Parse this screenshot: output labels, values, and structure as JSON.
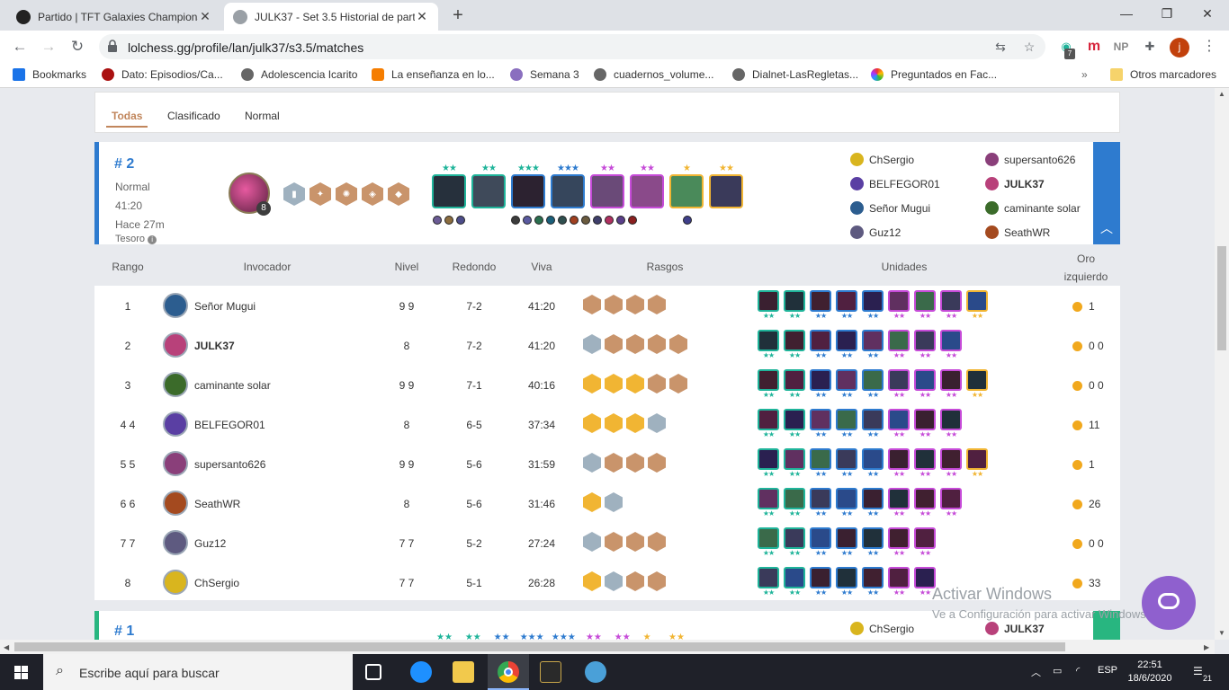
{
  "browser": {
    "tabs": [
      {
        "title": "Partido | TFT Galaxies Champions",
        "active": false
      },
      {
        "title": "JULK37 - Set 3.5 Historial de part",
        "active": true
      }
    ],
    "url": "lolchess.gg/profile/lan/julk37/s3.5/matches",
    "bookmarks": [
      "Bookmarks",
      "Dato: Episodios/Ca...",
      "Adolescencia Icarito",
      "La enseñanza en lo...",
      "Semana 3",
      "cuadernos_volume...",
      "Dialnet-LasRegletas...",
      "Preguntados en Fac...",
      "Otros marcadores"
    ],
    "ext_badge": "7",
    "ext_np": "NP",
    "profile_initial": "j"
  },
  "filters": [
    "Todas",
    "Clasificado",
    "Normal"
  ],
  "match": {
    "rank": "# 2",
    "mode": "Normal",
    "duration": "41:20",
    "ago": "Hace 27m",
    "reward": "Tesoro",
    "level": "8",
    "players_left": [
      "ChSergio",
      "BELFEGOR01",
      "Señor Mugui",
      "Guz12"
    ],
    "players_right": [
      "supersanto626",
      "JULK37",
      "caminante solar",
      "SeathWR"
    ],
    "unit_stars": [
      "★★",
      "★★",
      "★★★",
      "★★★",
      "★★",
      "★★",
      "★",
      "★★"
    ],
    "unit_star_colors": [
      "#1fb49a",
      "#1fb49a",
      "#1fb49a",
      "#2e7bcf",
      "#c64bd8",
      "#c64bd8",
      "#f1b533",
      "#f1b533"
    ],
    "unit_border_colors": [
      "#1fb49a",
      "#1fb49a",
      "#2e7bcf",
      "#2e7bcf",
      "#c64bd8",
      "#c64bd8",
      "#f1b533",
      "#f1b533"
    ]
  },
  "table": {
    "headers": {
      "rank": "Rango",
      "summoner": "Invocador",
      "level": "Nivel",
      "round": "Redondo",
      "alive": "Viva",
      "traits": "Rasgos",
      "units": "Unidades",
      "gold1": "Oro",
      "gold2": "izquierdo"
    },
    "rows": [
      {
        "rank": "1",
        "name": "Señor Mugui",
        "level": "9 9",
        "round": "7-2",
        "alive": "41:20",
        "gold": "1",
        "me": false,
        "avatar": "#2c5d8f",
        "traits": [
          "bronze",
          "bronze",
          "bronze",
          "bronze"
        ]
      },
      {
        "rank": "2",
        "name": "JULK37",
        "level": "8",
        "round": "7-2",
        "alive": "41:20",
        "gold": "0 0",
        "me": true,
        "avatar": "#b8417a",
        "traits": [
          "silver",
          "bronze",
          "bronze",
          "bronze",
          "bronze"
        ]
      },
      {
        "rank": "3",
        "name": "caminante solar",
        "level": "9 9",
        "round": "7-1",
        "alive": "40:16",
        "gold": "0 0",
        "me": false,
        "avatar": "#3b6b2a",
        "traits": [
          "gold",
          "gold",
          "gold",
          "bronze",
          "bronze"
        ]
      },
      {
        "rank": "4 4",
        "name": "BELFEGOR01",
        "level": "8",
        "round": "6-5",
        "alive": "37:34",
        "gold": "11",
        "me": false,
        "avatar": "#5a3fa3",
        "traits": [
          "gold",
          "gold",
          "gold",
          "silver"
        ]
      },
      {
        "rank": "5 5",
        "name": "supersanto626",
        "level": "9 9",
        "round": "5-6",
        "alive": "31:59",
        "gold": "1",
        "me": false,
        "avatar": "#8a3f7a",
        "traits": [
          "silver",
          "bronze",
          "bronze",
          "bronze"
        ]
      },
      {
        "rank": "6 6",
        "name": "SeathWR",
        "level": "8",
        "round": "5-6",
        "alive": "31:46",
        "gold": "26",
        "me": false,
        "avatar": "#a44a1f",
        "traits": [
          "gold",
          "silver"
        ]
      },
      {
        "rank": "7 7",
        "name": "Guz12",
        "level": "7 7",
        "round": "5-2",
        "alive": "27:24",
        "gold": "0 0",
        "me": false,
        "avatar": "#5e5a80",
        "traits": [
          "silver",
          "bronze",
          "bronze",
          "bronze"
        ]
      },
      {
        "rank": "8",
        "name": "ChSergio",
        "level": "7 7",
        "round": "5-1",
        "alive": "26:28",
        "gold": "33",
        "me": false,
        "avatar": "#d9b51e",
        "traits": [
          "gold",
          "silver",
          "bronze",
          "bronze"
        ]
      }
    ]
  },
  "match2": {
    "rank": "# 1",
    "player_left": "ChSergio",
    "player_right": "JULK37"
  },
  "watermark": {
    "line1": "Activar Windows",
    "line2": "Ve a Configuración para activar Windows."
  },
  "taskbar": {
    "search": "Escribe aquí para buscar",
    "lang": "ESP",
    "time": "22:51",
    "date": "18/6/2020",
    "notif": "21"
  }
}
